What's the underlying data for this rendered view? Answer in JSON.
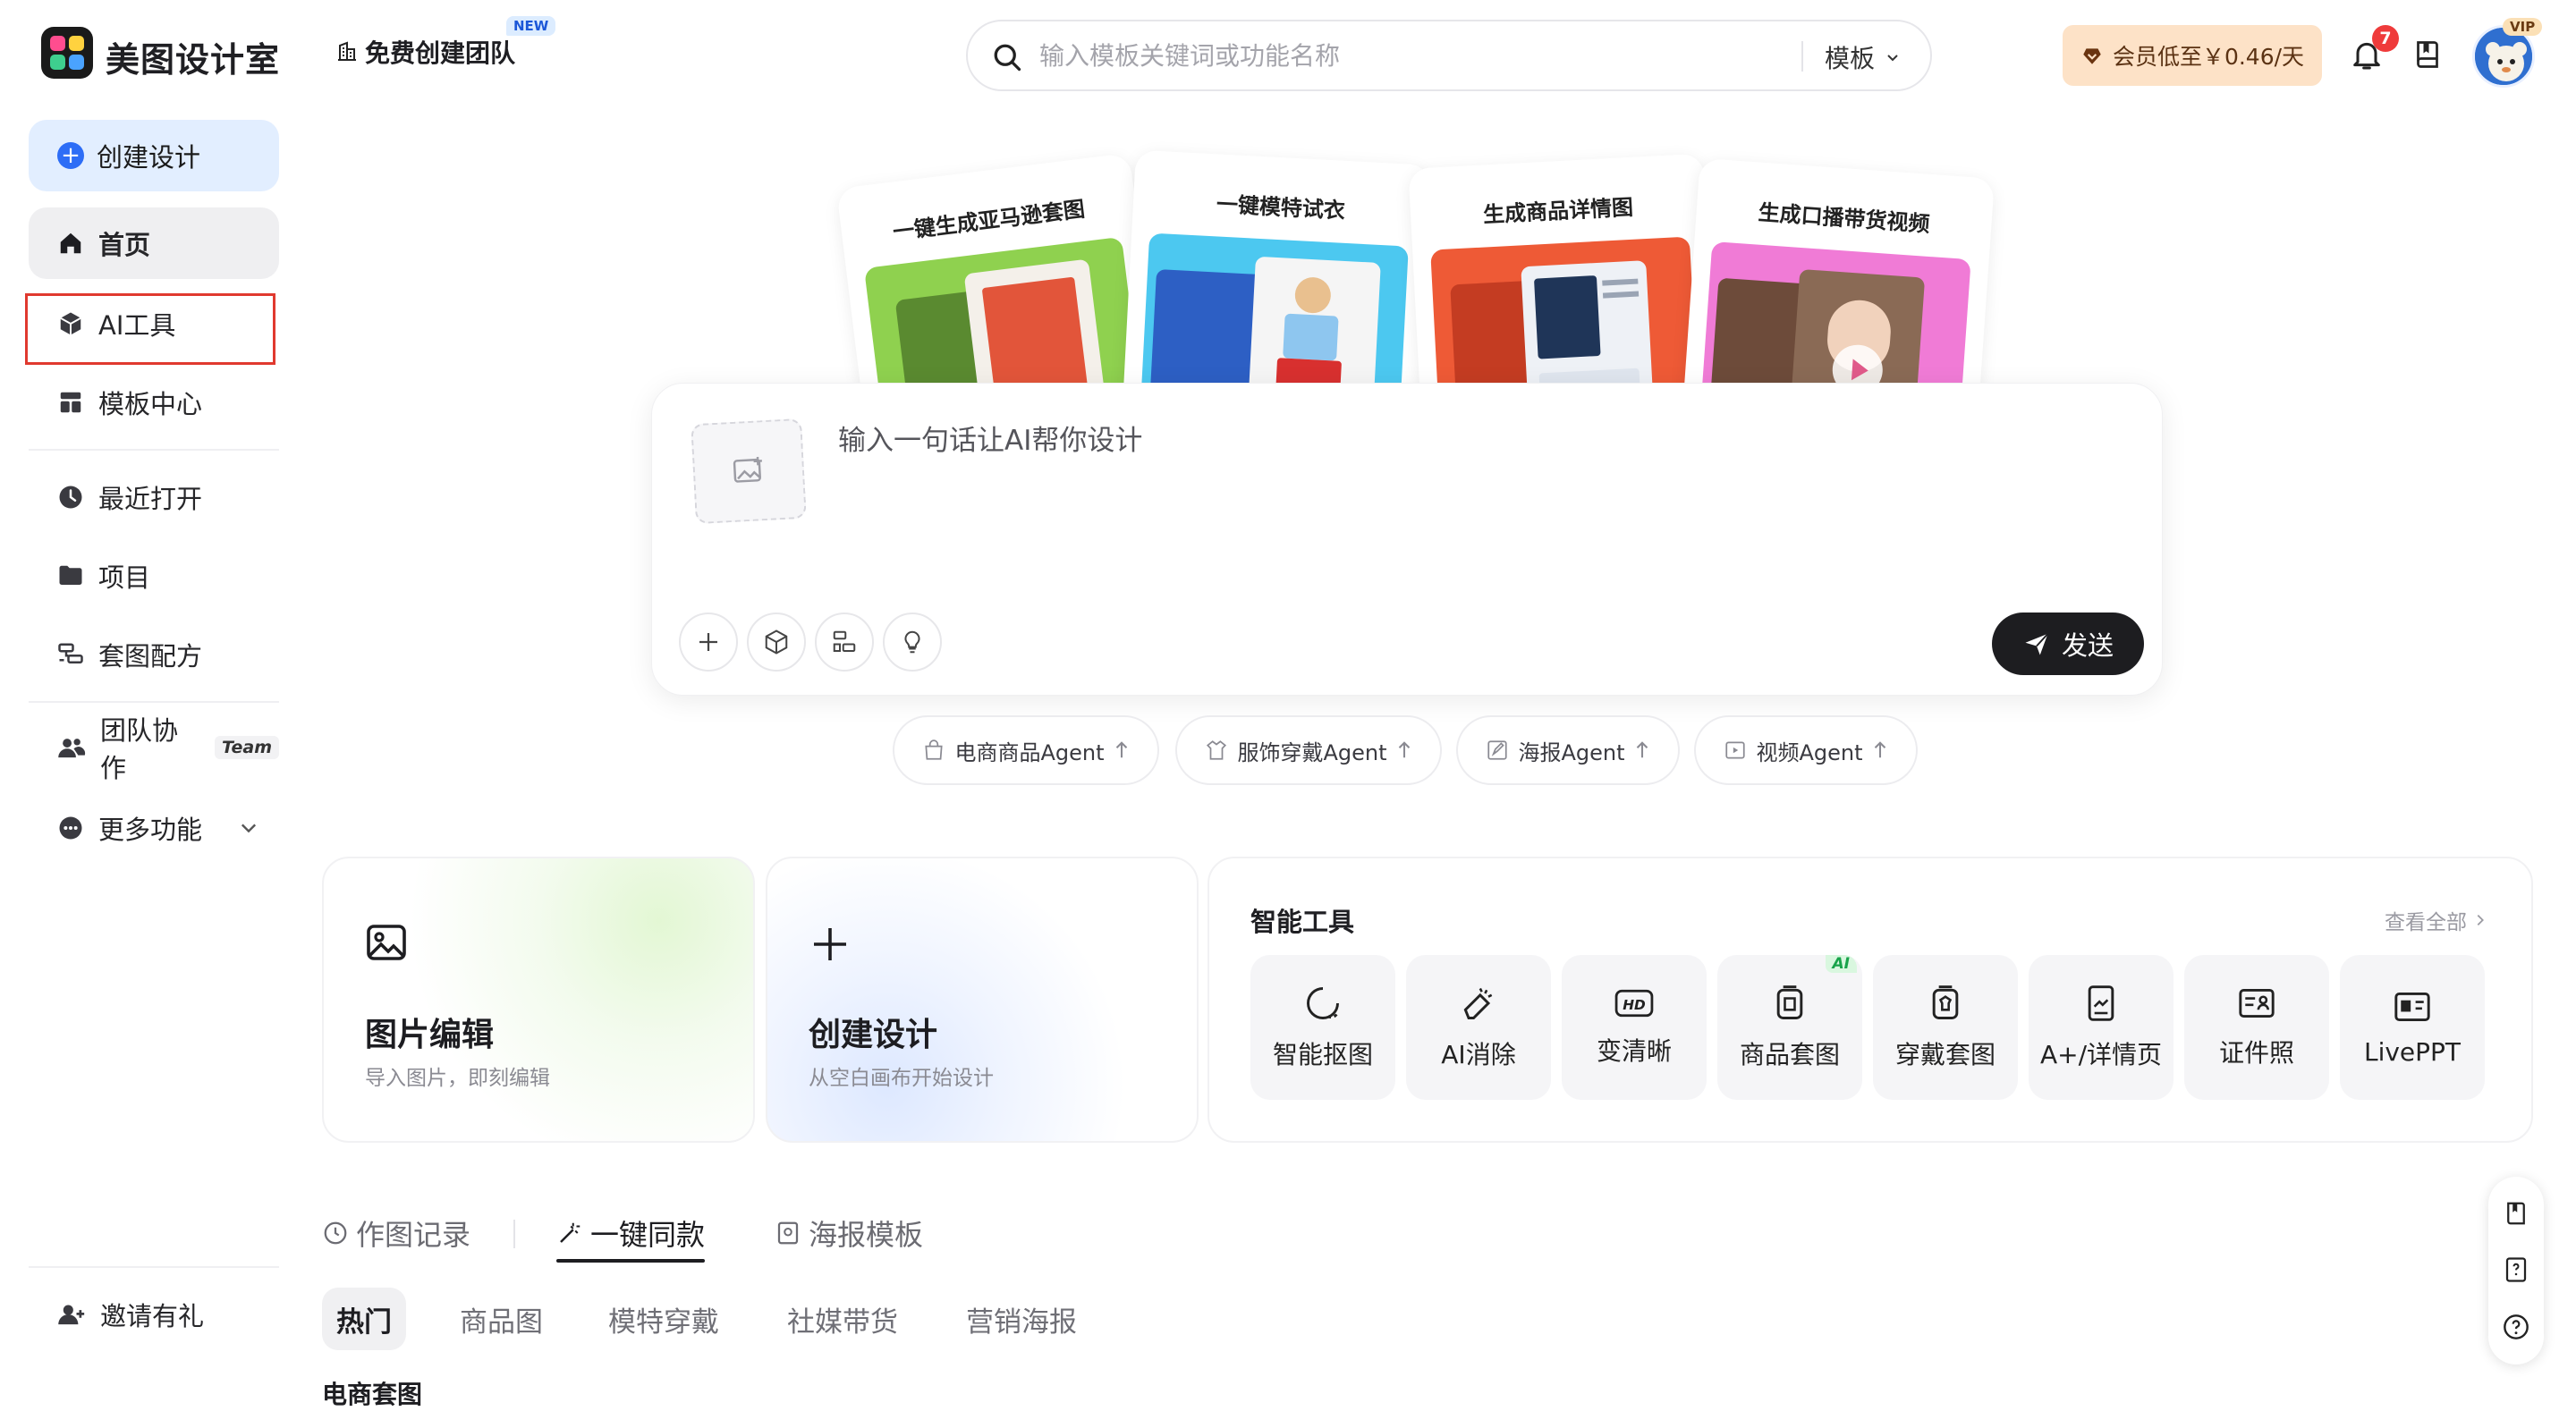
{
  "brand": {
    "name": "美图设计室"
  },
  "header": {
    "team_button": "免费创建团队",
    "new_badge": "NEW",
    "search_placeholder": "输入模板关键词或功能名称",
    "search_scope": "模板",
    "vip_button": "会员低至￥0.46/天",
    "notification_count": "7",
    "vip_tag": "VIP"
  },
  "sidebar": {
    "create": "创建设计",
    "items": [
      {
        "label": "首页",
        "icon": "home-icon"
      },
      {
        "label": "AI工具",
        "icon": "cube-icon"
      },
      {
        "label": "模板中心",
        "icon": "template-icon"
      },
      {
        "label": "最近打开",
        "icon": "clock-icon"
      },
      {
        "label": "项目",
        "icon": "folder-icon"
      },
      {
        "label": "套图配方",
        "icon": "recipe-icon"
      },
      {
        "label": "团队协作",
        "icon": "team-icon"
      },
      {
        "label": "更多功能",
        "icon": "more-icon"
      }
    ],
    "team_tag": "Team",
    "invite": "邀请有礼"
  },
  "hero_cards": [
    {
      "title": "一键生成亚马逊套图"
    },
    {
      "title": "一键模特试衣"
    },
    {
      "title": "生成商品详情图"
    },
    {
      "title": "生成口播带货视频"
    }
  ],
  "prompt": {
    "placeholder": "输入一句话让AI帮你设计",
    "send": "发送"
  },
  "agents": [
    {
      "label": "电商商品Agent"
    },
    {
      "label": "服饰穿戴Agent"
    },
    {
      "label": "海报Agent"
    },
    {
      "label": "视频Agent"
    }
  ],
  "feature_cards": [
    {
      "title": "图片编辑",
      "sub": "导入图片，即刻编辑"
    },
    {
      "title": "创建设计",
      "sub": "从空白画布开始设计"
    }
  ],
  "tools": {
    "title": "智能工具",
    "view_all": "查看全部",
    "ai_badge": "AI",
    "items": [
      {
        "label": "智能抠图"
      },
      {
        "label": "AI消除"
      },
      {
        "label": "变清晰"
      },
      {
        "label": "商品套图"
      },
      {
        "label": "穿戴套图"
      },
      {
        "label": "A+/详情页"
      },
      {
        "label": "证件照"
      },
      {
        "label": "LivePPT"
      }
    ]
  },
  "tabs": [
    {
      "label": "作图记录"
    },
    {
      "label": "一键同款"
    },
    {
      "label": "海报模板"
    }
  ],
  "chips": [
    {
      "label": "热门"
    },
    {
      "label": "商品图"
    },
    {
      "label": "模特穿戴"
    },
    {
      "label": "社媒带货"
    },
    {
      "label": "营销海报"
    }
  ],
  "section": {
    "title": "电商套图"
  },
  "colors": {
    "accent": "#2d6df6",
    "highlight": "#e0392f",
    "vip_bg": "#fde2c7"
  }
}
